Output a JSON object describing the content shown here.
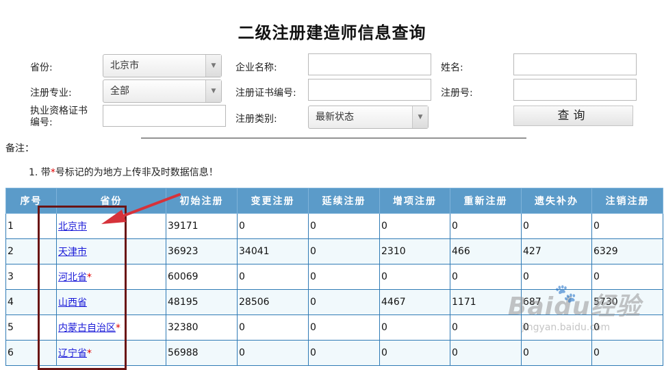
{
  "page": {
    "title": "二级注册建造师信息查询"
  },
  "form": {
    "province_label": "省份:",
    "province_value": "北京市",
    "company_label": "企业名称:",
    "company_value": "",
    "name_label": "姓名:",
    "name_value": "",
    "specialty_label": "注册专业:",
    "specialty_value": "全部",
    "cert_no_label": "注册证书编号:",
    "cert_no_value": "",
    "reg_no_label": "注册号:",
    "reg_no_value": "",
    "qual_cert_label_1": "执业资格证书",
    "qual_cert_label_2": "编号:",
    "qual_cert_value": "",
    "reg_type_label": "注册类别:",
    "reg_type_value": "最新状态",
    "query_button": "查询"
  },
  "notes": {
    "title": "备注：",
    "line_prefix": "1. 带",
    "line_star": "*",
    "line_suffix": "号标记的为地方上传非及时数据信息！"
  },
  "table": {
    "headers": [
      "序号",
      "省份",
      "初始注册",
      "变更注册",
      "延续注册",
      "增项注册",
      "重新注册",
      "遗失补办",
      "注销注册"
    ],
    "rows": [
      {
        "no": "1",
        "province": "北京市",
        "star": "",
        "initial": "39171",
        "change": "0",
        "extend": "0",
        "add": "0",
        "renew": "0",
        "reissue": "0",
        "cancel": "0"
      },
      {
        "no": "2",
        "province": "天津市",
        "star": "",
        "initial": "36923",
        "change": "34041",
        "extend": "0",
        "add": "2310",
        "renew": "466",
        "reissue": "427",
        "cancel": "6329"
      },
      {
        "no": "3",
        "province": "河北省",
        "star": "*",
        "initial": "60069",
        "change": "0",
        "extend": "0",
        "add": "0",
        "renew": "0",
        "reissue": "0",
        "cancel": "0"
      },
      {
        "no": "4",
        "province": "山西省",
        "star": "",
        "initial": "48195",
        "change": "28506",
        "extend": "0",
        "add": "4467",
        "renew": "1171",
        "reissue": "687",
        "cancel": "5730"
      },
      {
        "no": "5",
        "province": "内蒙古自治区",
        "star": "*",
        "initial": "32380",
        "change": "0",
        "extend": "0",
        "add": "0",
        "renew": "0",
        "reissue": "0",
        "cancel": "0"
      },
      {
        "no": "6",
        "province": "辽宁省",
        "star": "*",
        "initial": "56988",
        "change": "0",
        "extend": "0",
        "add": "0",
        "renew": "0",
        "reissue": "0",
        "cancel": "0"
      }
    ]
  },
  "watermark": {
    "brand": "Baidu",
    "cn": "经验",
    "url": "jingyan.baidu.com"
  },
  "colors": {
    "header_bg": "#5b9bc9",
    "border": "#2f7ab5",
    "link": "#1a1ad8",
    "star": "#e00000",
    "annotation": "#6a1414",
    "arrow": "#d6323a"
  }
}
